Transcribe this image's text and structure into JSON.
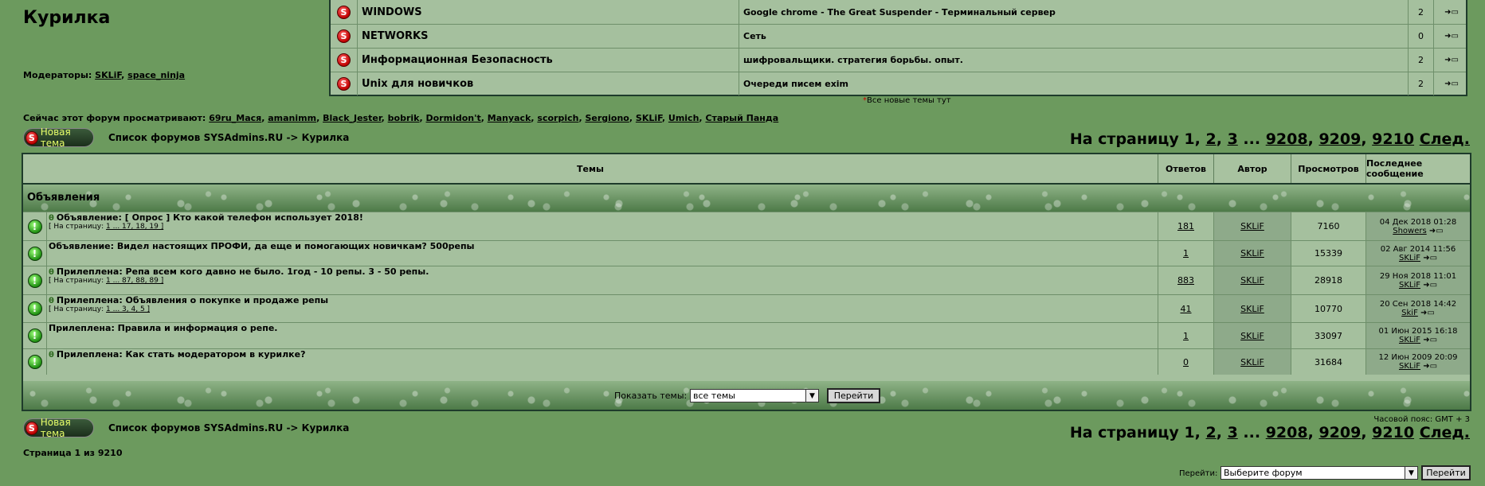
{
  "forum": {
    "title": "Курилка",
    "moderators_label": "Модераторы:",
    "moderators": [
      "SKLiF",
      "space_ninja"
    ]
  },
  "news": [
    {
      "name": "WINDOWS",
      "topic": "Google chrome - The Great Suspender - Терминальный сервер",
      "count": "2"
    },
    {
      "name": "NETWORKS",
      "topic": "Сеть",
      "count": "0"
    },
    {
      "name": "Информационная Безопасность",
      "topic": "шифровальщики. стратегия борьбы. опыт.",
      "count": "2"
    },
    {
      "name": "Unix для новичков",
      "topic": "Очереди писем exim",
      "count": "2"
    }
  ],
  "news_note": "Все новые темы тут",
  "viewers": {
    "label": "Сейчас этот форум просматривают:",
    "users": [
      "69ru_Мася",
      "amanimm",
      "Black_Jester",
      "bobrik",
      "Dormidon't",
      "Manyack",
      "scorpich",
      "Sergiono",
      "SKLiF",
      "Umich",
      "Старый Панда"
    ]
  },
  "new_topic_label": "Новая тема",
  "breadcrumb": "Список форумов SYSAdmins.RU -> Курилка",
  "pager": {
    "label": "На страницу",
    "pages": [
      "1",
      "2",
      "3",
      "...",
      "9208",
      "9209",
      "9210"
    ],
    "next": "След."
  },
  "table": {
    "headers": {
      "topics": "Темы",
      "replies": "Ответов",
      "author": "Автор",
      "views": "Просмотров",
      "last": "Последнее сообщение"
    },
    "category": "Объявления",
    "rows": [
      {
        "pinned": true,
        "title": "Объявление: [ Опрос ] Кто какой телефон использует 2018!",
        "pages_label": "[ На страницу:",
        "pages": "1 ... 17, 18, 19 ]",
        "replies": "181",
        "author": "SKLiF",
        "views": "7160",
        "last_date": "04 Дек 2018 01:28",
        "last_user": "Showers"
      },
      {
        "pinned": false,
        "title": "Объявление: Видел настоящих ПРОФИ, да еще и помогающих новичкам? 500репы",
        "pages_label": "",
        "pages": "",
        "replies": "1",
        "author": "SKLiF",
        "views": "15339",
        "last_date": "02 Авг 2014 11:56",
        "last_user": "SKLiF"
      },
      {
        "pinned": true,
        "title": "Прилеплена: Репа всем кого давно не было. 1год - 10 репы. 3 - 50 репы.",
        "pages_label": "[ На страницу:",
        "pages": "1 ... 87, 88, 89 ]",
        "replies": "883",
        "author": "SKLiF",
        "views": "28918",
        "last_date": "29 Ноя 2018 11:01",
        "last_user": "SKLiF"
      },
      {
        "pinned": true,
        "title": "Прилеплена: Объявления о покупке и продаже репы",
        "pages_label": "[ На страницу:",
        "pages": "1 ... 3, 4, 5 ]",
        "replies": "41",
        "author": "SKLiF",
        "views": "10770",
        "last_date": "20 Сен 2018 14:42",
        "last_user": "SkiF"
      },
      {
        "pinned": false,
        "title": "Прилеплена: Правила и информация о репе.",
        "pages_label": "",
        "pages": "",
        "replies": "1",
        "author": "SKLiF",
        "views": "33097",
        "last_date": "01 Июн 2015 16:18",
        "last_user": "SKLiF"
      },
      {
        "pinned": true,
        "title": "Прилеплена: Как стать модератором в курилке?",
        "pages_label": "",
        "pages": "",
        "replies": "0",
        "author": "SKLiF",
        "views": "31684",
        "last_date": "12 Июн 2009 20:09",
        "last_user": "SKLiF"
      }
    ],
    "show_label": "Показать темы:",
    "show_value": "все темы",
    "go_label": "Перейти"
  },
  "timezone": "Часовой пояс: GMT + 3",
  "page_of": "Страница 1 из 9210",
  "jump": {
    "label": "Перейти:",
    "value": "Выберите форум",
    "button": "Перейти"
  },
  "colors": {
    "background": "#6c9a5e",
    "table": "#a5c09e",
    "accent": "#e8ff6a"
  }
}
